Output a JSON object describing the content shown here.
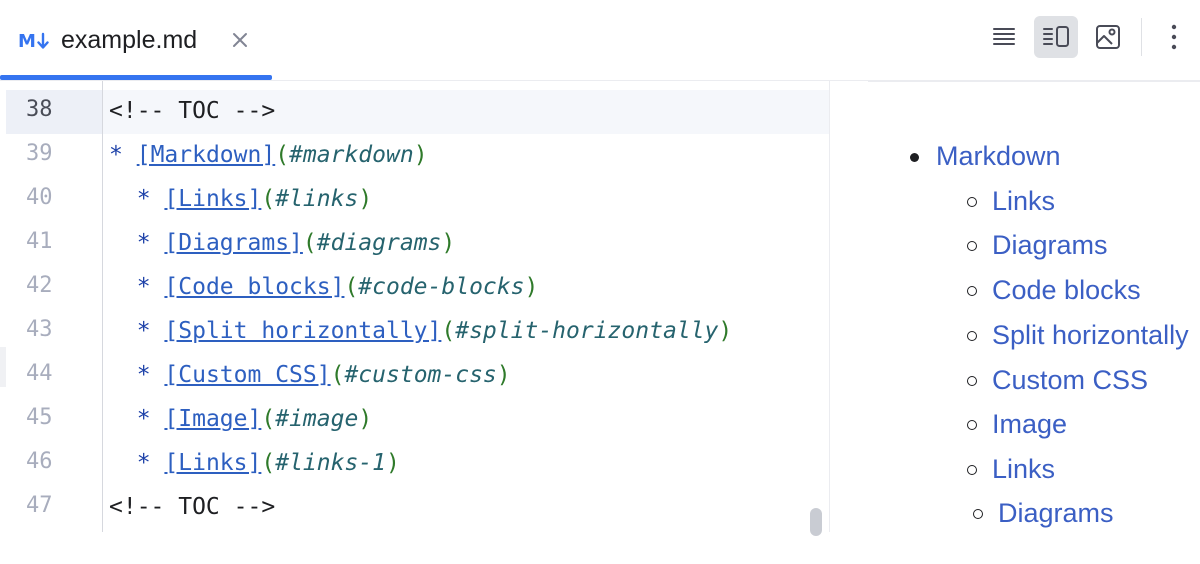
{
  "tab": {
    "icon": "markdown-icon",
    "icon_label": "M↓",
    "title": "example.md",
    "close": "close-icon"
  },
  "toolbar": {
    "buttons": [
      {
        "name": "editor-only-icon",
        "active": false
      },
      {
        "name": "editor-and-preview-icon",
        "active": true
      },
      {
        "name": "preview-only-icon",
        "active": false
      },
      {
        "name": "more-options-icon",
        "active": false
      }
    ]
  },
  "editor": {
    "current_line": 38,
    "lines": [
      {
        "num": "38",
        "text": "<!-- TOC -->"
      },
      {
        "num": "39",
        "bullet": "*",
        "indent": "",
        "link": "[Markdown]",
        "open": "(",
        "url": "#markdown",
        "close": ")"
      },
      {
        "num": "40",
        "bullet": "*",
        "indent": "  ",
        "link": "[Links]",
        "open": "(",
        "url": "#links",
        "close": ")"
      },
      {
        "num": "41",
        "bullet": "*",
        "indent": "  ",
        "link": "[Diagrams]",
        "open": "(",
        "url": "#diagrams",
        "close": ")"
      },
      {
        "num": "42",
        "bullet": "*",
        "indent": "  ",
        "link": "[Code blocks]",
        "open": "(",
        "url": "#code-blocks",
        "close": ")"
      },
      {
        "num": "43",
        "bullet": "*",
        "indent": "  ",
        "link": "[Split horizontally]",
        "open": "(",
        "url": "#split-horizontally",
        "close": ")"
      },
      {
        "num": "44",
        "bullet": "*",
        "indent": "  ",
        "link": "[Custom CSS]",
        "open": "(",
        "url": "#custom-css",
        "close": ")"
      },
      {
        "num": "45",
        "bullet": "*",
        "indent": "  ",
        "link": "[Image]",
        "open": "(",
        "url": "#image",
        "close": ")"
      },
      {
        "num": "46",
        "bullet": "*",
        "indent": "  ",
        "link": "[Links]",
        "open": "(",
        "url": "#links-1",
        "close": ")"
      },
      {
        "num": "47",
        "text": "<!-- TOC -->"
      }
    ]
  },
  "preview": {
    "items": [
      {
        "text": "Markdown",
        "level": 1
      },
      {
        "text": "Links",
        "level": 2
      },
      {
        "text": "Diagrams",
        "level": 2
      },
      {
        "text": "Code blocks",
        "level": 2
      },
      {
        "text": "Split horizontally",
        "level": 2
      },
      {
        "text": "Custom CSS",
        "level": 2
      },
      {
        "text": "Image",
        "level": 2
      },
      {
        "text": "Links",
        "level": 2
      },
      {
        "text": "Diagrams",
        "level": 2
      }
    ]
  },
  "colors": {
    "accent": "#3574f0",
    "link": "#3b5fc4"
  }
}
